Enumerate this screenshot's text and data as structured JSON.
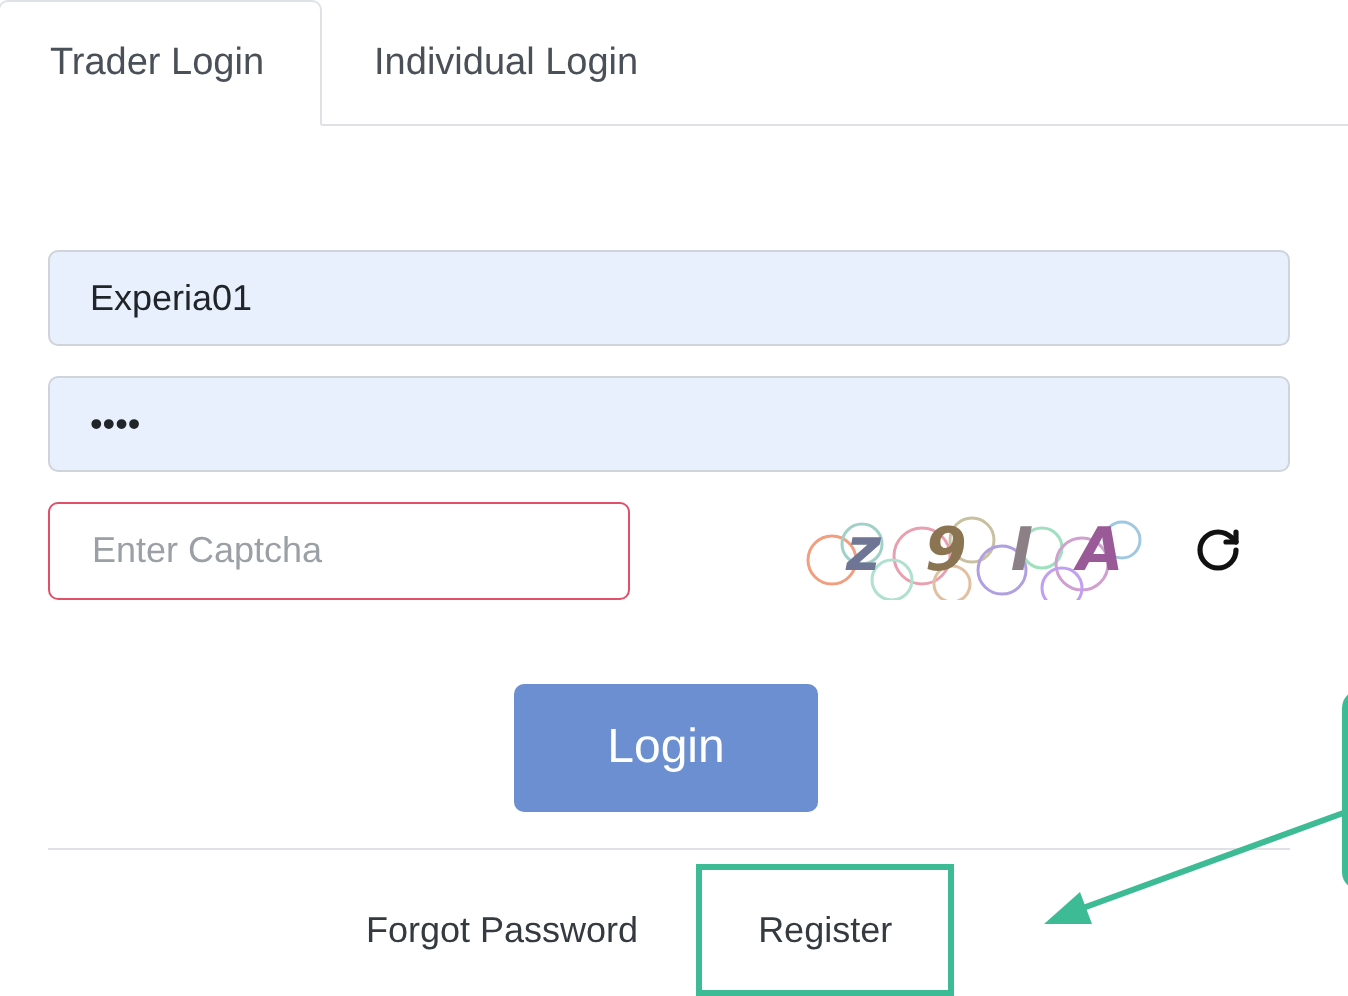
{
  "tabs": [
    {
      "label": "Trader Login",
      "selected": true
    },
    {
      "label": "Individual Login",
      "selected": false
    }
  ],
  "username": {
    "value": "Experia01"
  },
  "password": {
    "value": "••••"
  },
  "captcha": {
    "placeholder": "Enter Captcha",
    "invalid": true,
    "characters": [
      "z",
      "9",
      "I",
      "A"
    ]
  },
  "login_button": {
    "label": "Login"
  },
  "links": [
    {
      "label": "Forgot Password",
      "highlighted": false
    },
    {
      "label": "Register",
      "highlighted": true
    }
  ],
  "annotations": {
    "arrow": true,
    "callout": true
  }
}
